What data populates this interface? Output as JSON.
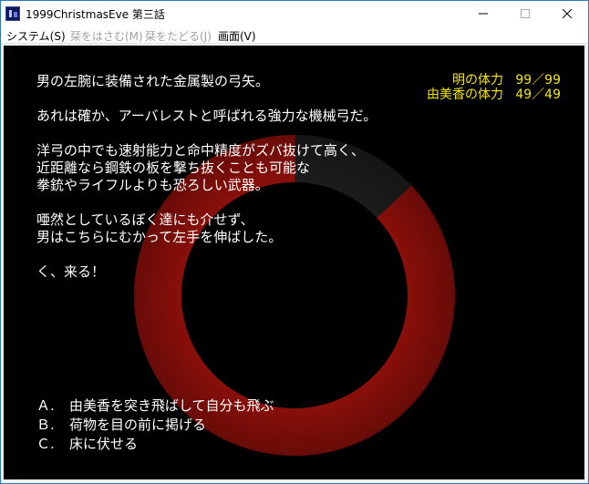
{
  "window": {
    "title": "1999ChristmasEve 第三話",
    "controls": {
      "minimize": "—",
      "maximize": "☐",
      "close": "✕"
    }
  },
  "menu": [
    {
      "label": "システム(S)",
      "enabled": true
    },
    {
      "label": "栞をはさむ(M)",
      "enabled": false
    },
    {
      "label": "栞をたどる(J)",
      "enabled": false
    },
    {
      "label": "画面(V)",
      "enabled": true
    }
  ],
  "status": {
    "akira": {
      "label": "明の体力",
      "current": "99",
      "max": "99",
      "text": "99／99"
    },
    "yumika": {
      "label": "由美香の体力",
      "current": "49",
      "max": "49",
      "text": "49／49"
    },
    "color": "#f5e600"
  },
  "story": {
    "lines": [
      "男の左腕に装備された金属製の弓矢。",
      "",
      "あれは確か、アーバレストと呼ばれる強力な機械弓だ。",
      "",
      "洋弓の中でも速射能力と命中精度がズバ抜けて高く、",
      "近距離なら鋼鉄の板を撃ち抜くことも可能な",
      "拳銃やライフルよりも恐ろしい武器。",
      "",
      "唖然としているぼく達にも介せず、",
      "男はこちらにむかって左手を伸ばした。",
      "",
      "く、来る！"
    ]
  },
  "choices": [
    {
      "key": "Ａ.",
      "text": "由美香を突き飛ばして自分も飛ぶ"
    },
    {
      "key": "Ｂ.",
      "text": "荷物を目の前に掲げる"
    },
    {
      "key": "Ｃ.",
      "text": "床に伏せる"
    }
  ],
  "timer_ring": {
    "remaining_fraction": 0.87,
    "color": "#8a0f0a",
    "spent_color": "#1c1c1c"
  }
}
